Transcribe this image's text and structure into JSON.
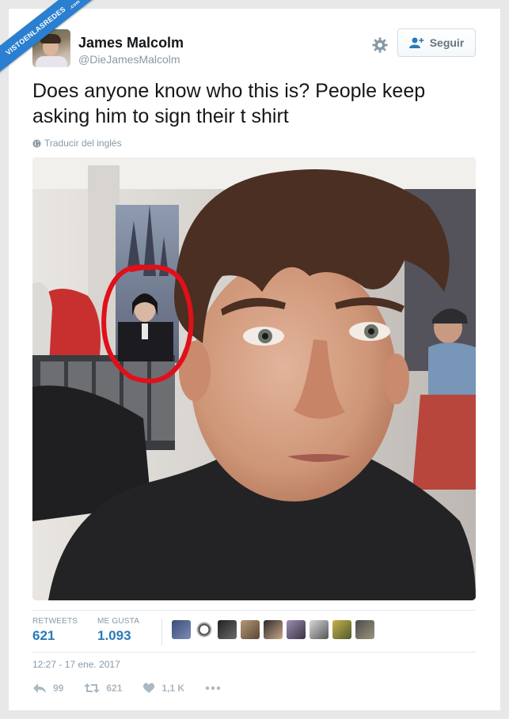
{
  "watermark": {
    "text": "VISTOENLASREDES",
    "suffix": ".com"
  },
  "user": {
    "name": "James Malcolm",
    "handle": "@DieJamesMalcolm"
  },
  "follow_label": "Seguir",
  "tweet": {
    "text": "Does anyone know who this is? People keep asking him to sign their t shirt",
    "translate_label": "Traducir del inglés"
  },
  "stats": {
    "retweets_label": "RETWEETS",
    "retweets_value": "621",
    "likes_label": "ME GUSTA",
    "likes_value": "1.093"
  },
  "timestamp": "12:27 - 17 ene. 2017",
  "actions": {
    "reply_count": "99",
    "retweet_count": "621",
    "like_count": "1,1 K"
  },
  "colors": {
    "accent": "#2a7ab8",
    "muted": "#8899a6",
    "circle": "#e0101a"
  }
}
